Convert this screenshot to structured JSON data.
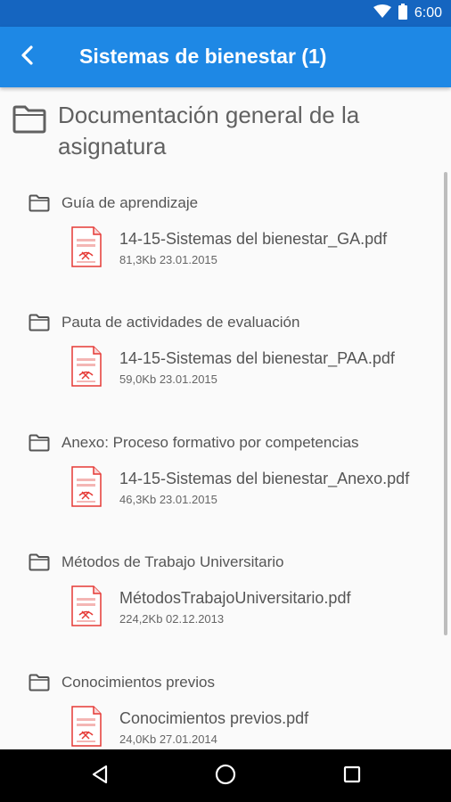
{
  "status_bar": {
    "time": "6:00",
    "icons": [
      "wifi-icon",
      "battery-icon"
    ]
  },
  "app_bar": {
    "title": "Sistemas de bienestar (1)",
    "back_icon": "back-chevron-icon",
    "color": "#1e88e5",
    "status_color": "#1565c0"
  },
  "section": {
    "title": "Documentación general de la asignatura"
  },
  "folders": [
    {
      "name": "Guía de aprendizaje",
      "file": {
        "name": "14-15-Sistemas del bienestar_GA.pdf",
        "meta": "81,3Kb 23.01.2015"
      }
    },
    {
      "name": "Pauta de actividades de evaluación",
      "file": {
        "name": "14-15-Sistemas del bienestar_PAA.pdf",
        "meta": "59,0Kb 23.01.2015"
      }
    },
    {
      "name": "Anexo: Proceso formativo por competencias",
      "file": {
        "name": "14-15-Sistemas del bienestar_Anexo.pdf",
        "meta": "46,3Kb 23.01.2015"
      }
    },
    {
      "name": "Métodos de Trabajo Universitario",
      "file": {
        "name": "MétodosTrabajoUniversitario.pdf",
        "meta": "224,2Kb 02.12.2013"
      }
    },
    {
      "name": "Conocimientos previos",
      "file": {
        "name": "Conocimientos previos.pdf",
        "meta": "24,0Kb 27.01.2014"
      }
    }
  ],
  "nav_bar": {
    "buttons": [
      "back-triangle-icon",
      "home-circle-icon",
      "recents-square-icon"
    ]
  },
  "colors": {
    "pdf_red": "#e53935",
    "text_gray": "#555555"
  }
}
